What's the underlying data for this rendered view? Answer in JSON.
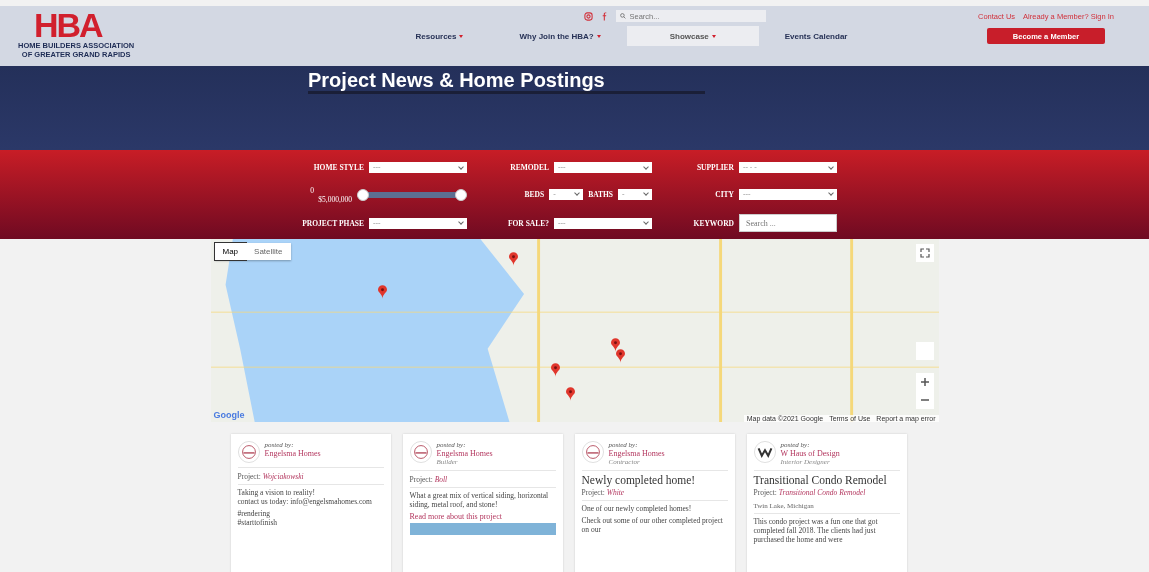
{
  "logo": {
    "letters": "HBA",
    "line_1": "HOME BUILDERS ASSOCIATION",
    "line_2": "OF GREATER GRAND RAPIDS"
  },
  "search": {
    "placeholder": "Search..."
  },
  "top_links": [
    "Contact Us",
    "Already a Member? Sign In"
  ],
  "nav": [
    {
      "label": "Resources",
      "dropdown": true,
      "selected": false
    },
    {
      "label": "Why Join the HBA?",
      "dropdown": true,
      "selected": false
    },
    {
      "label": "Showcase",
      "dropdown": true,
      "selected": true
    },
    {
      "label": "Events Calendar",
      "dropdown": false,
      "selected": false
    }
  ],
  "cta": "Become a Member",
  "hero": {
    "title": "Project News & Home Postings"
  },
  "filters": [
    {
      "kind": "select",
      "label": "HOME STYLE",
      "value": "---"
    },
    {
      "kind": "select",
      "label": "REMODEL",
      "value": "---"
    },
    {
      "kind": "select",
      "label": "SUPPLIER",
      "value": "--  -  -"
    },
    {
      "kind": "range",
      "low": "0",
      "high": "$5,000,000",
      "level": 1
    },
    {
      "kind": "pair",
      "label": "BEDS",
      "value": "-",
      "label_2": "BATHS",
      "value_2": "-"
    },
    {
      "kind": "select",
      "label": "CITY",
      "value": "---"
    },
    {
      "kind": "select",
      "label": "PROJECT PHASE",
      "value": "---"
    },
    {
      "kind": "select",
      "label": "FOR SALE?",
      "value": "---"
    },
    {
      "kind": "search",
      "label": "KEYWORD",
      "placeholder": "Search ..."
    }
  ],
  "map": {
    "types": [
      {
        "label": "Map",
        "selected": true
      },
      {
        "label": "Satellite",
        "selected": false
      }
    ],
    "logo": "Google",
    "footer": [
      "Map data ©2021 Google",
      "Terms of Use",
      "Report a map error"
    ]
  },
  "cards": [
    {
      "kind": "engelsma",
      "posted_by": "posted by:",
      "author": "Engelsma Homes",
      "project_label": "Project:",
      "project": "Wojciakowski",
      "body": [
        "Taking a vision to reality!\ncontact us today: info@engelsmahomes.com",
        "#rendering\n#starttofinish"
      ],
      "photo": false
    },
    {
      "kind": "engelsma",
      "posted_by": "posted by:",
      "author": "Engelsma Homes",
      "role": "Builder",
      "project_label": "Project:",
      "project": "Boll",
      "body": [
        "What a great mix of vertical siding, horizontal siding, metal roof, and stone!"
      ],
      "read_more": "Read more about this project",
      "photo": true
    },
    {
      "kind": "engelsma",
      "posted_by": "posted by:",
      "author": "Engelsma Homes",
      "role": "Contractor",
      "title": "Newly completed home!",
      "project_label": "Project:",
      "project": "White",
      "body": [
        "One of our newly completed homes!",
        "Check out some of our other completed project on our"
      ],
      "photo": false
    },
    {
      "kind": "w",
      "posted_by": "posted by:",
      "author": "W Haus of Design",
      "role": "Interior Designer",
      "title": "Transitional Condo Remodel",
      "project_label": "Project:",
      "project": "Transitional Condo Remodel",
      "location": "Twin Lake, Michigan",
      "body": [
        "This condo project was a fun one that got completed fall 2018. The clients had just purchased the home and were"
      ],
      "photo": false
    }
  ]
}
